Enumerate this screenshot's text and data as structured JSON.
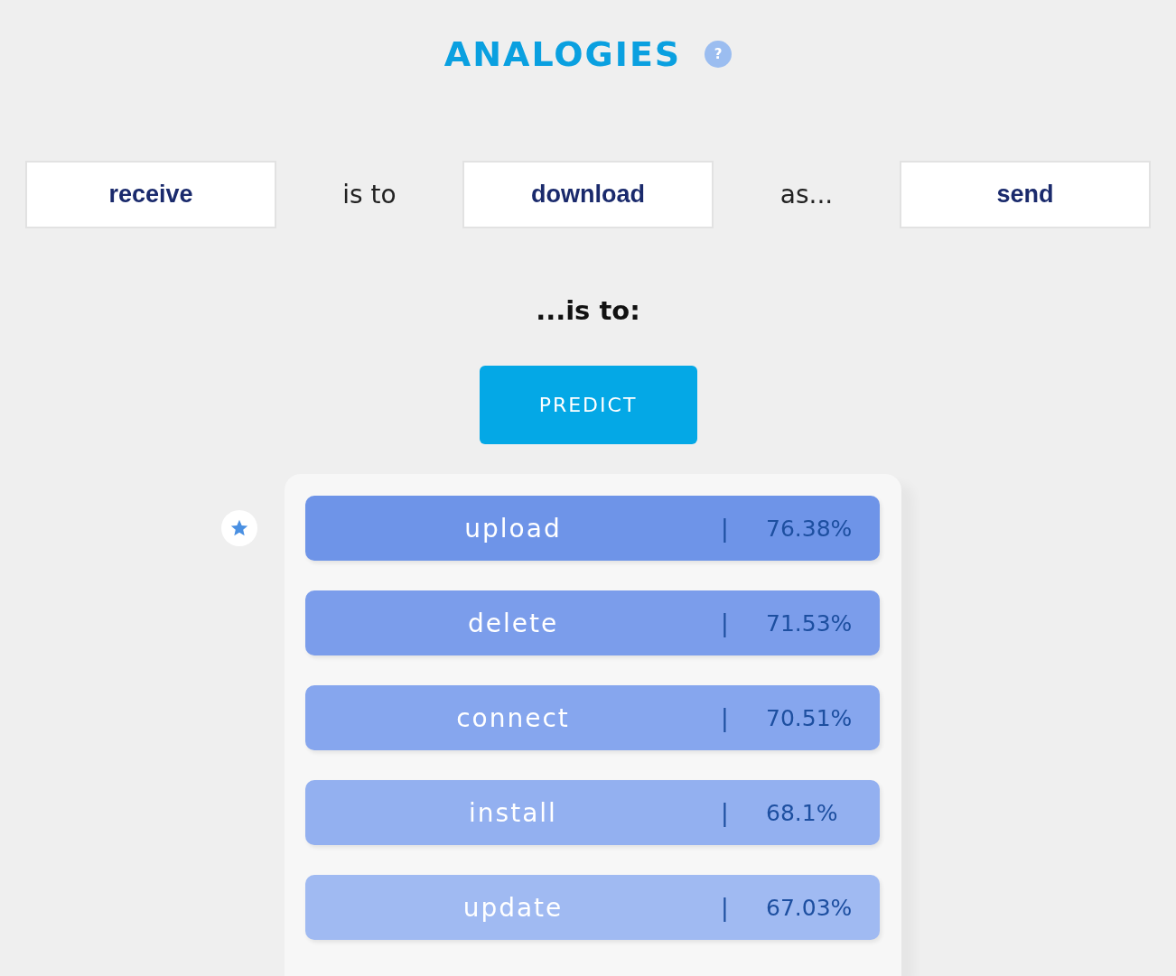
{
  "title": "ANALOGIES",
  "help": "?",
  "analogy": {
    "first": "receive",
    "connector_1": "is to",
    "second": "download",
    "connector_2": "as...",
    "third": "send",
    "result_label": "...is to:"
  },
  "predict_button": "PREDICT",
  "results": [
    {
      "word": "upload",
      "separator": "|",
      "score": "76.38%",
      "color": "#6e94e8",
      "starred": true
    },
    {
      "word": "delete",
      "separator": "|",
      "score": "71.53%",
      "color": "#7b9deb",
      "starred": false
    },
    {
      "word": "connect",
      "separator": "|",
      "score": "70.51%",
      "color": "#86a6ee",
      "starred": false
    },
    {
      "word": "install",
      "separator": "|",
      "score": "68.1%",
      "color": "#93b0f0",
      "starred": false
    },
    {
      "word": "update",
      "separator": "|",
      "score": "67.03%",
      "color": "#a0baf2",
      "starred": false
    }
  ]
}
